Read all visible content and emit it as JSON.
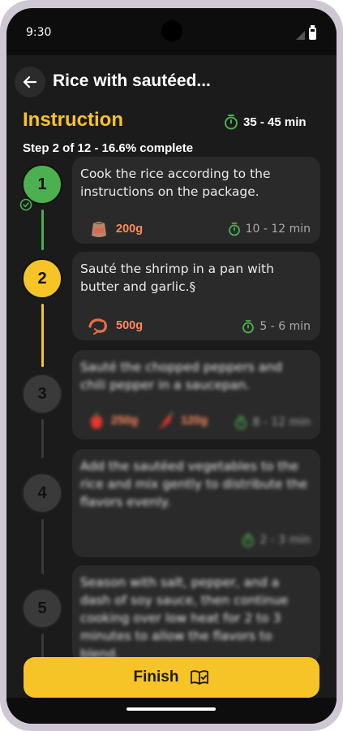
{
  "status_bar": {
    "time": "9:30"
  },
  "header": {
    "title": "Rice with sautéed..."
  },
  "instruction": {
    "section_title": "Instruction",
    "total_time": "35 - 45 min",
    "progress_text": "Step 2 of 12 - 16.6% complete",
    "progress_fraction": 0.166
  },
  "steps": [
    {
      "number": "1",
      "state": "done",
      "text": "Cook the rice according to the instructions on the package.",
      "ingredients": [
        {
          "icon": "rice-sack-icon",
          "amount": "200g"
        }
      ],
      "time": "10 - 12 min"
    },
    {
      "number": "2",
      "state": "active",
      "text": "Sauté the shrimp in a pan with butter and garlic.§",
      "ingredients": [
        {
          "icon": "shrimp-icon",
          "amount": "500g"
        }
      ],
      "time": "5 - 6 min"
    },
    {
      "number": "3",
      "state": "locked",
      "text": "Sauté the chopped peppers and chili pepper in a saucepan.",
      "ingredients": [
        {
          "icon": "bell-pepper-icon",
          "amount": "250g"
        },
        {
          "icon": "chili-pepper-icon",
          "amount": "120g"
        }
      ],
      "time": "8 - 12 min"
    },
    {
      "number": "4",
      "state": "locked",
      "text": "Add the sautéed vegetables to the rice and mix gently to distribute the flavors evenly.",
      "ingredients": [],
      "time": "2 - 3 min"
    },
    {
      "number": "5",
      "state": "locked",
      "text": "Season with salt, pepper, and a dash of soy sauce, then continue cooking over low heat for 2 to 3 minutes to allow the flavors to blend.",
      "ingredients": [],
      "time": ""
    }
  ],
  "footer": {
    "finish_label": "Finish"
  },
  "colors": {
    "accent": "#f7c427",
    "done": "#4caf50",
    "ingredient": "#ff8a5c",
    "background": "#1b1b1b",
    "card": "#2a2a2a"
  }
}
